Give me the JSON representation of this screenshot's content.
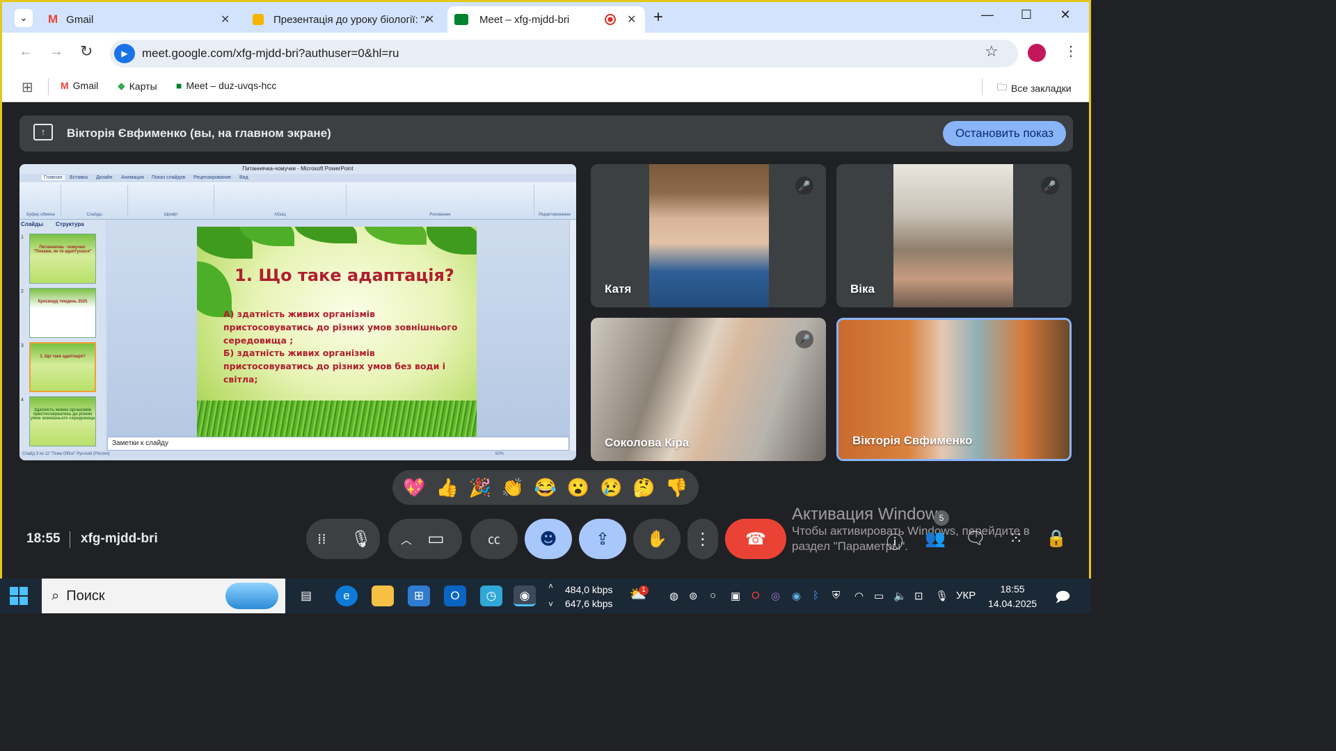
{
  "tabs": [
    {
      "title": "Gmail"
    },
    {
      "title": "Презентація до уроку біології: \"А"
    },
    {
      "title": "Meet – xfg-mjdd-bri"
    }
  ],
  "address": {
    "url": "meet.google.com/xfg-mjdd-bri?authuser=0&hl=ru"
  },
  "bookmarks": {
    "items": [
      "Gmail",
      "Карты",
      "Meet – duz-uvqs-hcc"
    ],
    "all": "Все закладки"
  },
  "banner": {
    "text": "Вікторія Євфименко (вы, на главном экране)",
    "stop": "Остановить показ"
  },
  "ppt": {
    "window_title": "Питаннячка-чомучки - Microsoft PowerPoint",
    "tabs": [
      "Главная",
      "Вставка",
      "Дизайн",
      "Анимация",
      "Показ слайдов",
      "Рецензирование",
      "Вид"
    ],
    "groups": [
      "Буфер обмена",
      "Слайды",
      "Шрифт",
      "Абзац",
      "Рисование",
      "Редактирование"
    ],
    "panel_tabs": [
      "Слайды",
      "Структура"
    ],
    "thumbs": [
      "Питаннячка - чомучки: \"Покажи, як ти адаптуєшся\"",
      "Кросворд тиждень 2025",
      "1. Що таке адаптація?",
      "Здатність живих організмів пристосовуватись до різних умов зовнішнього середовища"
    ],
    "notes": "Заметки к слайду",
    "status": "Слайд 3 из 12   \"Тема Office\"   Русский (Россия)",
    "zoom": "62%"
  },
  "slide": {
    "title": "1. Що таке адаптація?",
    "a": "А) здатність живих організмів пристосовуватись до різних умов зовнішнього середовища ;",
    "b": "Б) здатність живих організмів пристосовуватись до різних умов без води і світла;"
  },
  "participants": [
    "Катя",
    "Віка",
    "Соколова Кіра",
    "Вікторія Євфименко"
  ],
  "reactions": [
    "💖",
    "👍",
    "🎉",
    "👏",
    "😂",
    "😮",
    "😢",
    "🤔",
    "👎"
  ],
  "bottom": {
    "time": "18:55",
    "code": "xfg-mjdd-bri",
    "participants_count": "5"
  },
  "watermark": {
    "line1": "Активация Windows",
    "line2": "Чтобы активировать Windows, перейдите в",
    "line3": "раздел \"Параметры\"."
  },
  "taskbar": {
    "search": "Поиск",
    "net_up": "484,0 kbps",
    "net_down": "647,6 kbps",
    "weather_badge": "1",
    "lang": "УКР",
    "time": "18:55",
    "date": "14.04.2025"
  },
  "colors": {
    "accent": "#8ab4f8",
    "end_call": "#ea4335",
    "frame": "#e3c819"
  }
}
